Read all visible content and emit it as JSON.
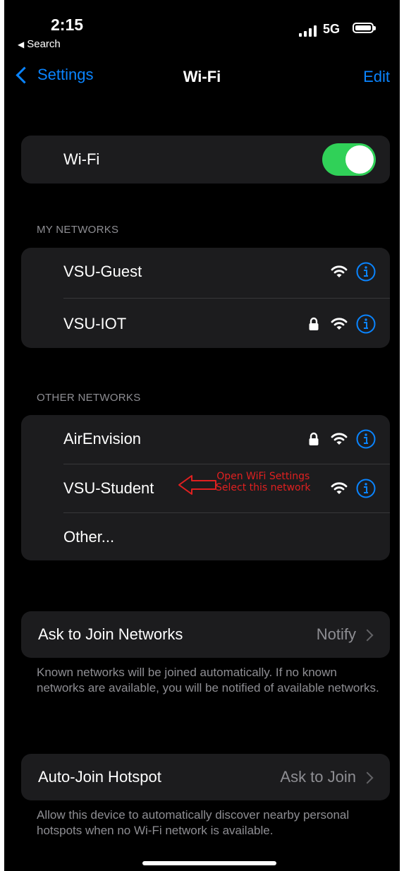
{
  "status_bar": {
    "time": "2:15",
    "back_app": "Search",
    "network_type": "5G"
  },
  "nav": {
    "back_label": "Settings",
    "title": "Wi-Fi",
    "action_label": "Edit"
  },
  "wifi_toggle": {
    "label": "Wi-Fi",
    "on": true
  },
  "my_networks": {
    "header": "MY NETWORKS",
    "items": [
      {
        "name": "VSU-Guest",
        "locked": false
      },
      {
        "name": "VSU-IOT",
        "locked": true
      }
    ]
  },
  "other_networks": {
    "header": "OTHER NETWORKS",
    "items": [
      {
        "name": "AirEnvision",
        "locked": true
      },
      {
        "name": "VSU-Student",
        "locked": false
      }
    ],
    "other_label": "Other..."
  },
  "annotation": {
    "line1": "Open WiFi Settings",
    "line2": "Select this network",
    "color": "#e02020"
  },
  "ask_to_join": {
    "label": "Ask to Join Networks",
    "value": "Notify",
    "footnote": "Known networks will be joined automatically. If no known networks are available, you will be notified of available networks."
  },
  "auto_join_hotspot": {
    "label": "Auto-Join Hotspot",
    "value": "Ask to Join",
    "footnote": "Allow this device to automatically discover nearby personal hotspots when no Wi-Fi network is available."
  },
  "colors": {
    "accent": "#0a84ff",
    "toggle_on": "#30d158",
    "group_bg": "#1c1c1e",
    "secondary_text": "#8e8e93"
  }
}
